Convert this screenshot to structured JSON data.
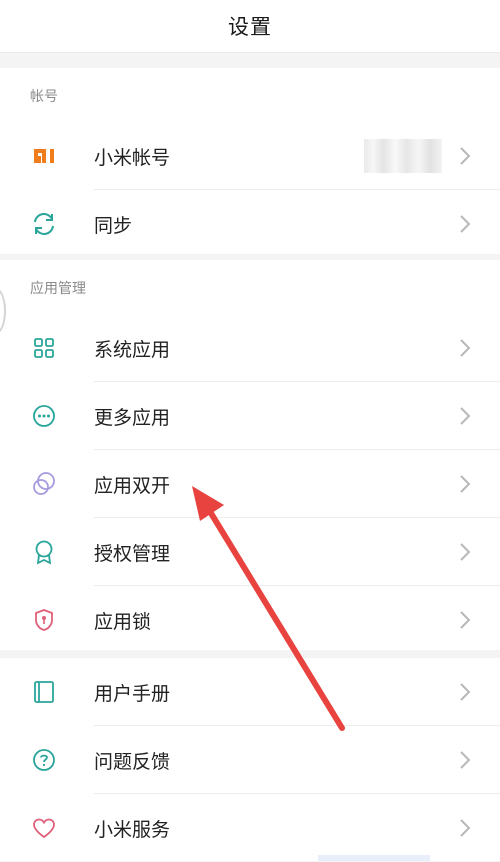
{
  "header": {
    "title": "设置"
  },
  "sections": [
    {
      "title": "帐号",
      "items": [
        {
          "label": "小米帐号",
          "icon": "mi-logo-icon",
          "value": ""
        },
        {
          "label": "同步",
          "icon": "sync-icon"
        }
      ]
    },
    {
      "title": "应用管理",
      "items": [
        {
          "label": "系统应用",
          "icon": "grid-apps-icon"
        },
        {
          "label": "更多应用",
          "icon": "more-dots-icon"
        },
        {
          "label": "应用双开",
          "icon": "dual-apps-icon"
        },
        {
          "label": "授权管理",
          "icon": "badge-icon"
        },
        {
          "label": "应用锁",
          "icon": "shield-lock-icon"
        }
      ]
    },
    {
      "title": "",
      "items": [
        {
          "label": "用户手册",
          "icon": "manual-icon"
        },
        {
          "label": "问题反馈",
          "icon": "question-icon"
        },
        {
          "label": "小米服务",
          "icon": "heart-icon"
        }
      ]
    }
  ],
  "colors": {
    "accent_orange": "#f07c1c",
    "teal": "#2aa59a",
    "lavender": "#a79be0",
    "rose": "#e0607a",
    "annotation_arrow": "#e8433f"
  }
}
